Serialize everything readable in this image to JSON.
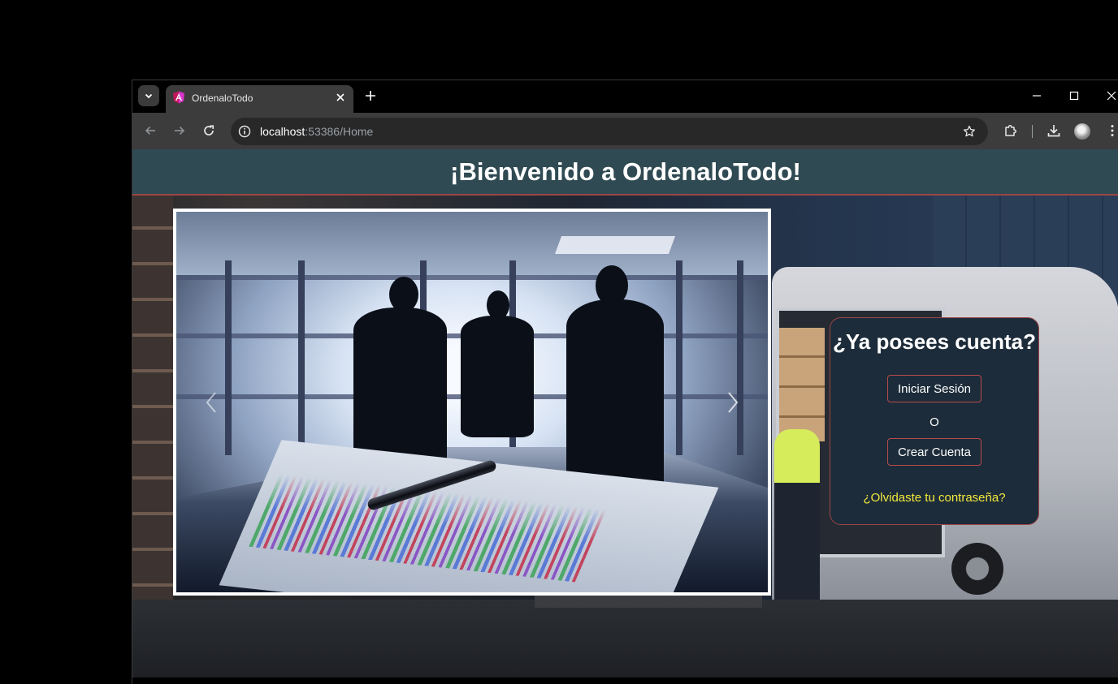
{
  "browser": {
    "tab": {
      "title": "OrdenaloTodo"
    },
    "address_bar": {
      "host": "localhost",
      "path": ":53386/Home"
    }
  },
  "page": {
    "header": {
      "title": "¡Bienvenido a OrdenaloTodo!"
    },
    "login_card": {
      "title": "¿Ya posees cuenta?",
      "login_button": "Iniciar Sesión",
      "or_text": "O",
      "register_button": "Crear Cuenta",
      "forgot_link": "¿Olvidaste tu contraseña?"
    }
  },
  "colors": {
    "header_bg": "#2f4a52",
    "accent_border": "#9c4545",
    "card_bg": "#1d2c3a",
    "link": "#f3ea3a"
  },
  "icons": {
    "tab_search": "chevron-down-icon",
    "favicon": "angular-icon",
    "tab_close": "close-icon",
    "new_tab": "plus-icon",
    "back": "arrow-left-icon",
    "forward": "arrow-right-icon",
    "reload": "reload-icon",
    "site_info": "info-icon",
    "bookmark": "star-icon",
    "extensions": "puzzle-icon",
    "downloads": "download-icon",
    "menu": "kebab-icon",
    "carousel_prev": "chevron-left-icon",
    "carousel_next": "chevron-right-icon"
  }
}
